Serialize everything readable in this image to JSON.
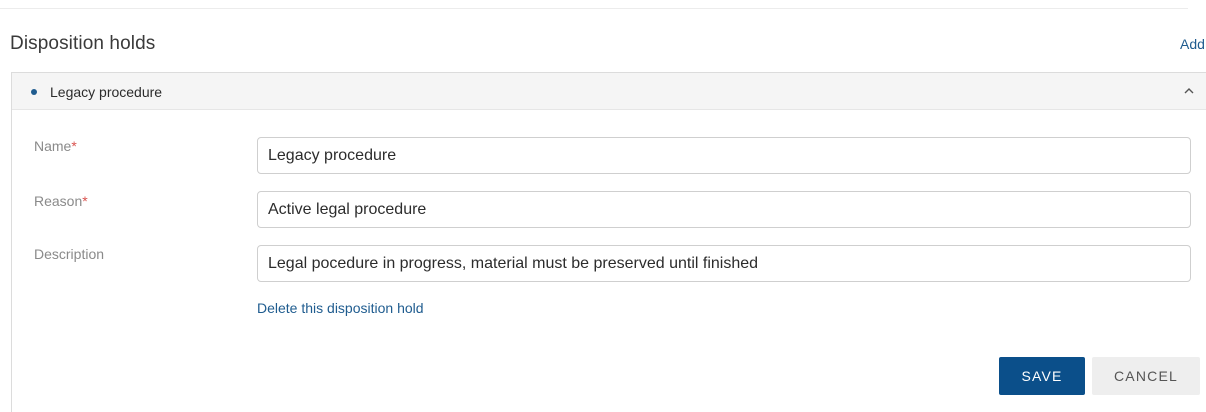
{
  "section": {
    "title": "Disposition holds",
    "add_label": "Add"
  },
  "hold": {
    "header_label": "Legacy procedure",
    "fields": {
      "name": {
        "label": "Name",
        "required_mark": "*",
        "value": "Legacy procedure"
      },
      "reason": {
        "label": "Reason",
        "required_mark": "*",
        "value": "Active legal procedure"
      },
      "description": {
        "label": "Description",
        "value": "Legal pocedure in progress, material must be preserved until finished"
      }
    },
    "delete_label": "Delete this disposition hold"
  },
  "actions": {
    "save_label": "SAVE",
    "cancel_label": "CANCEL"
  },
  "colors": {
    "accent": "#0b4f8a",
    "link": "#1f5c8f",
    "required": "#d9534f"
  },
  "icons": {
    "expand_toggle": "chevron-up-icon",
    "status_dot": "bullet-icon"
  }
}
